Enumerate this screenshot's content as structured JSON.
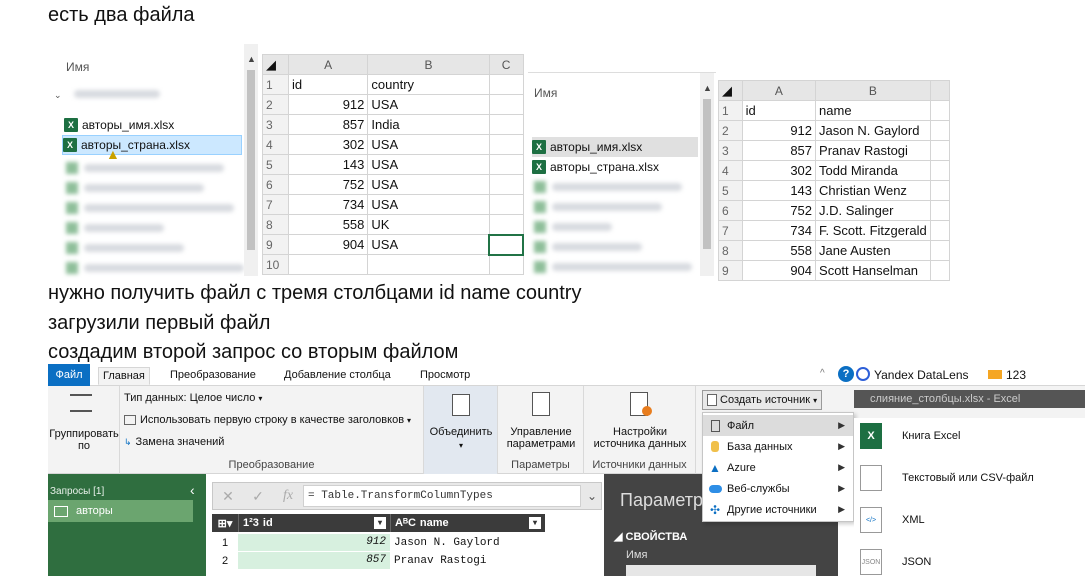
{
  "captions": {
    "line1": "есть два файла",
    "line2": "нужно получить файл с тремя столбцами id name country",
    "line3": "загрузили первый файл",
    "line4": "создадим второй запрос со вторым файлом"
  },
  "explorer1": {
    "header": "Имя",
    "files": [
      "авторы_имя.xlsx",
      "авторы_страна.xlsx"
    ],
    "file_icon": "X"
  },
  "sheet1": {
    "columns": [
      "A",
      "B"
    ],
    "rows": [
      {
        "n": "1",
        "a": "id",
        "b": "country"
      },
      {
        "n": "2",
        "a": "912",
        "b": "USA"
      },
      {
        "n": "3",
        "a": "857",
        "b": "India"
      },
      {
        "n": "4",
        "a": "302",
        "b": "USA"
      },
      {
        "n": "5",
        "a": "143",
        "b": "USA"
      },
      {
        "n": "6",
        "a": "752",
        "b": "USA"
      },
      {
        "n": "7",
        "a": "734",
        "b": "USA"
      },
      {
        "n": "8",
        "a": "558",
        "b": "UK"
      },
      {
        "n": "9",
        "a": "904",
        "b": "USA"
      },
      {
        "n": "10",
        "a": "",
        "b": ""
      }
    ]
  },
  "explorer2": {
    "header": "Имя",
    "files": [
      "авторы_имя.xlsx",
      "авторы_страна.xlsx"
    ],
    "file_icon": "X"
  },
  "sheet2": {
    "columns": [
      "A",
      "B"
    ],
    "rows": [
      {
        "n": "1",
        "a": "id",
        "b": "name"
      },
      {
        "n": "2",
        "a": "912",
        "b": "Jason N. Gaylord"
      },
      {
        "n": "3",
        "a": "857",
        "b": "Pranav Rastogi"
      },
      {
        "n": "4",
        "a": "302",
        "b": "Todd Miranda"
      },
      {
        "n": "5",
        "a": "143",
        "b": "Christian Wenz"
      },
      {
        "n": "6",
        "a": "752",
        "b": "J.D. Salinger"
      },
      {
        "n": "7",
        "a": "734",
        "b": "F. Scott. Fitzgerald"
      },
      {
        "n": "8",
        "a": "558",
        "b": "Jane Austen"
      },
      {
        "n": "9",
        "a": "904",
        "b": "Scott Hanselman"
      }
    ]
  },
  "pq": {
    "tabs": [
      "Файл",
      "Главная",
      "Преобразование",
      "Добавление столбца",
      "Просмотр"
    ],
    "top_right": {
      "yandex": "Yandex DataLens",
      "badge": "123"
    },
    "window_title": "слияние_столбцы.xlsx - Excel",
    "ribbon": {
      "group_btn": "Группировать\nпо",
      "data_type": "Тип данных: Целое число",
      "first_row": "Использовать первую строку в качестве заголовков",
      "replace": "Замена значений",
      "transform_label": "Преобразование",
      "combine": "Объединить",
      "manage_params": "Управление\nпараметрами",
      "params_label": "Параметры",
      "source_settings": "Настройки\nисточника данных",
      "sources_label": "Источники данных",
      "new_source": "Создать источник"
    },
    "new_source_menu": [
      "Файл",
      "База данных",
      "Azure",
      "Веб-службы",
      "Другие источники"
    ],
    "file_submenu": [
      {
        "label": "Книга Excel",
        "icon": "X"
      },
      {
        "label": "Текстовый или CSV-файл",
        "icon": ""
      },
      {
        "label": "XML",
        "icon": "</>"
      },
      {
        "label": "JSON",
        "icon": "JSON"
      }
    ],
    "queries_title": "Запросы [1]",
    "query_item": "авторы",
    "formula": "= Table.TransformColumnTypes",
    "formula_fx": "fx",
    "grid": {
      "headers": [
        {
          "type": "1²3",
          "name": "id"
        },
        {
          "type": "AᴮC",
          "name": "name"
        }
      ],
      "rows": [
        {
          "n": "1",
          "id": "912",
          "name": "Jason N. Gaylord"
        },
        {
          "n": "2",
          "id": "857",
          "name": "Pranav Rastogi"
        }
      ]
    },
    "props": {
      "title": "Параметры",
      "section": "СВОЙСТВА",
      "name_label": "Имя"
    }
  }
}
